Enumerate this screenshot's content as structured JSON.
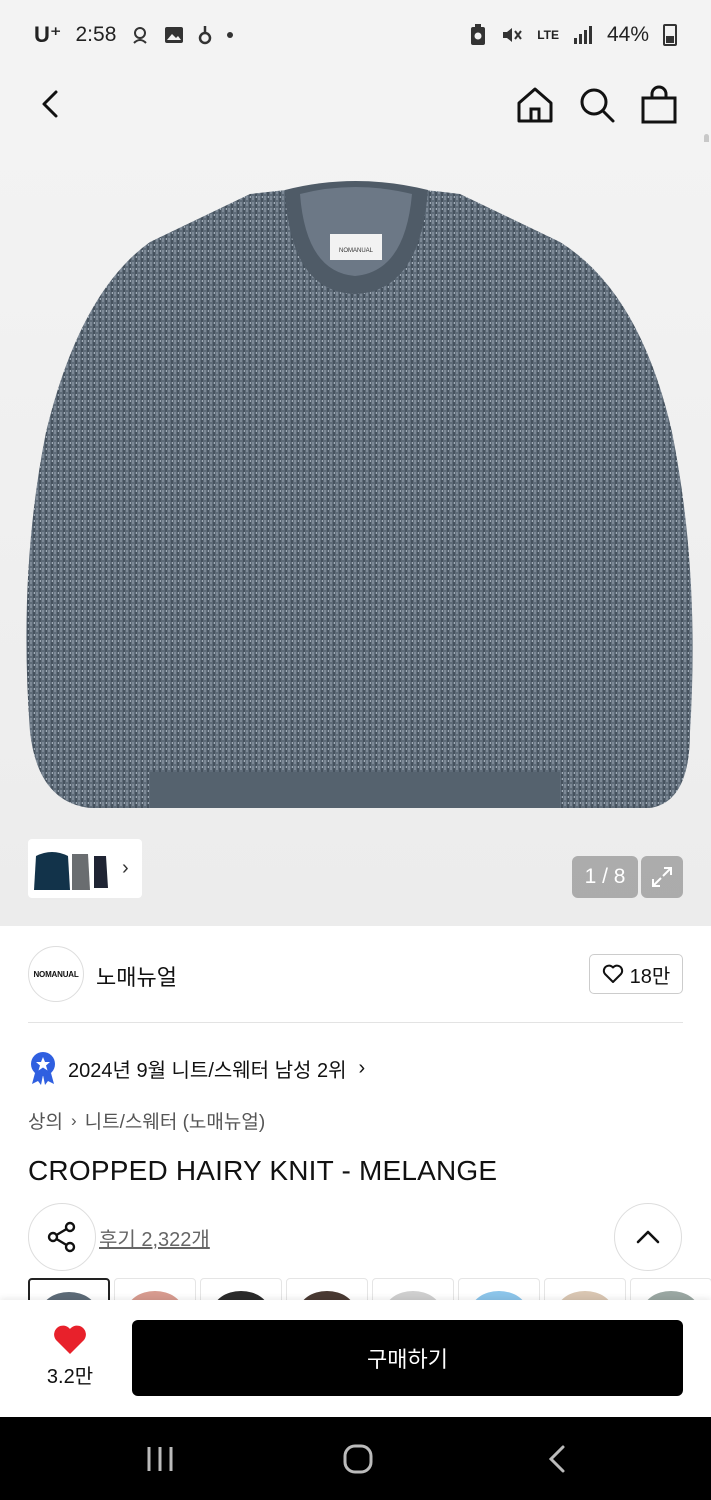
{
  "status_bar": {
    "carrier": "U⁺",
    "time": "2:58",
    "network": "LTE",
    "battery": "44%"
  },
  "icons": {
    "back": "back-arrow-icon",
    "home": "home-icon",
    "search": "search-icon",
    "bag": "shopping-bag-icon",
    "expand": "expand-icon",
    "share": "share-icon",
    "scroll_top": "chevron-up-icon",
    "heart": "heart-icon",
    "rank_badge": "rank-medal-icon"
  },
  "hero": {
    "page_counter": "1 / 8",
    "neck_label": "NOMANUAL",
    "thumb_colors": [
      "#12334a",
      "#6a6d70",
      "#1f2433"
    ]
  },
  "brand": {
    "logo_text": "NOMANUAL",
    "name": "노매뉴얼",
    "like_count": "18만"
  },
  "ranking": {
    "text": "2024년 9월 니트/스웨터 남성 2위",
    "chevron": "›"
  },
  "breadcrumb": {
    "category": "상의",
    "subcategory": "니트/스웨터 (노매뉴얼)",
    "separator": "›"
  },
  "product": {
    "title": "CROPPED HAIRY KNIT - MELANGE",
    "review_link": "후기 2,322개"
  },
  "swatches": [
    {
      "color": "#5d6b78"
    },
    {
      "color": "#d79b8f"
    },
    {
      "color": "#2b2b2b"
    },
    {
      "color": "#4a3a33"
    },
    {
      "color": "#cfcfcf"
    },
    {
      "color": "#8cc5ea"
    },
    {
      "color": "#d9c6b2"
    },
    {
      "color": "#9aa7a2"
    }
  ],
  "purchase_bar": {
    "wish_count": "3.2만",
    "buy_label": "구매하기"
  },
  "colors": {
    "heart_red": "#e8212b",
    "rank_badge_blue": "#2f5fe0"
  }
}
